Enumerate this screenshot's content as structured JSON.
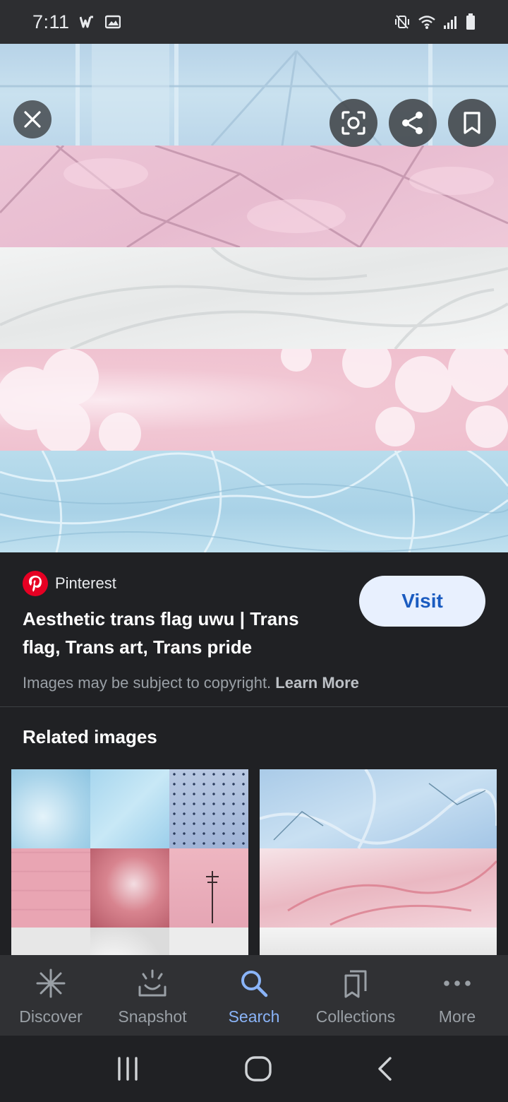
{
  "status_bar": {
    "time": "7:11",
    "left_icons": [
      "word-app-icon",
      "image-notification-icon"
    ],
    "right_icons": [
      "vibrate-mute-icon",
      "wifi-icon",
      "signal-icon",
      "battery-icon"
    ]
  },
  "hero": {
    "stripe_colors": [
      "#b7d3e8",
      "#ecc5d6",
      "#f2f3f3",
      "#f1c6d3",
      "#b9dcec"
    ],
    "buttons": [
      "close-icon",
      "lens-icon",
      "share-icon",
      "bookmark-icon"
    ]
  },
  "result": {
    "source": "Pinterest",
    "title": "Aesthetic trans flag uwu | Trans flag, Trans art, Trans pride",
    "visit_label": "Visit",
    "copyright_text": "Images may be subject to copyright.",
    "learn_more": "Learn More"
  },
  "related": {
    "heading": "Related images"
  },
  "bottom_nav": {
    "items": [
      {
        "label": "Discover",
        "icon": "asterisk-icon"
      },
      {
        "label": "Snapshot",
        "icon": "snapshot-icon"
      },
      {
        "label": "Search",
        "icon": "search-icon",
        "active": true
      },
      {
        "label": "Collections",
        "icon": "collections-icon"
      },
      {
        "label": "More",
        "icon": "more-dots-icon"
      }
    ]
  },
  "colors": {
    "accent": "#8ab4f8",
    "visit_bg": "#e8f0fe",
    "visit_text": "#1a5bc0",
    "pinterest_red": "#e60023"
  }
}
